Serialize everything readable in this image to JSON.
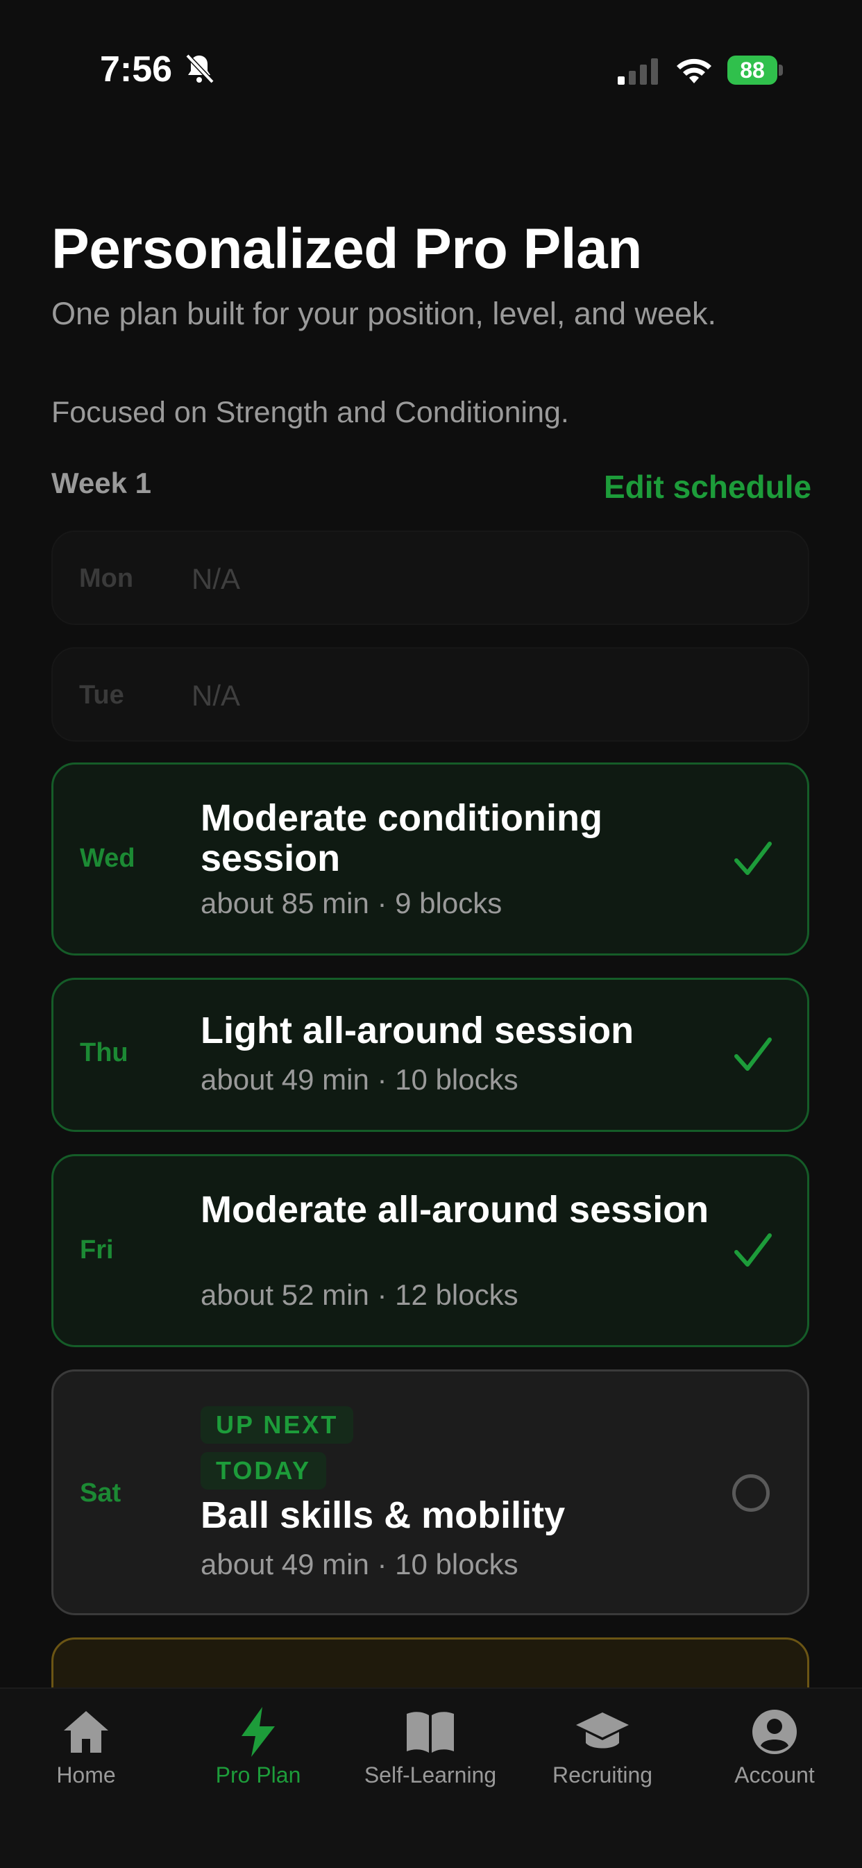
{
  "status_bar": {
    "time": "7:56",
    "battery": "88"
  },
  "header": {
    "title": "Personalized Pro Plan",
    "subtitle": "One plan built for your position, level, and week.",
    "focus": "Focused on Strength and Conditioning."
  },
  "week": {
    "label": "Week 1",
    "edit_label": "Edit schedule"
  },
  "days": [
    {
      "day": "Mon",
      "text": "N/A",
      "state": "none"
    },
    {
      "day": "Tue",
      "text": "N/A",
      "state": "none"
    },
    {
      "day": "Wed",
      "title": "Moderate conditioning session",
      "meta": "about 85 min · 9 blocks",
      "state": "completed"
    },
    {
      "day": "Thu",
      "title": "Light all-around session",
      "meta": "about 49 min · 10 blocks",
      "state": "completed"
    },
    {
      "day": "Fri",
      "title": "Moderate all-around session",
      "meta": "about 52 min · 12 blocks",
      "state": "completed"
    },
    {
      "day": "Sat",
      "badges": [
        "UP NEXT",
        "TODAY"
      ],
      "title": "Ball skills & mobility",
      "meta": "about 49 min · 10 blocks",
      "state": "pending"
    }
  ],
  "tabs": [
    {
      "label": "Home",
      "icon": "home-icon"
    },
    {
      "label": "Pro Plan",
      "icon": "bolt-icon",
      "active": true
    },
    {
      "label": "Self-Learning",
      "icon": "book-icon"
    },
    {
      "label": "Recruiting",
      "icon": "graduation-cap-icon"
    },
    {
      "label": "Account",
      "icon": "account-icon"
    }
  ],
  "colors": {
    "accent": "#1d9c3a",
    "background": "#0e0e0e",
    "card_done_border": "#155c28"
  }
}
